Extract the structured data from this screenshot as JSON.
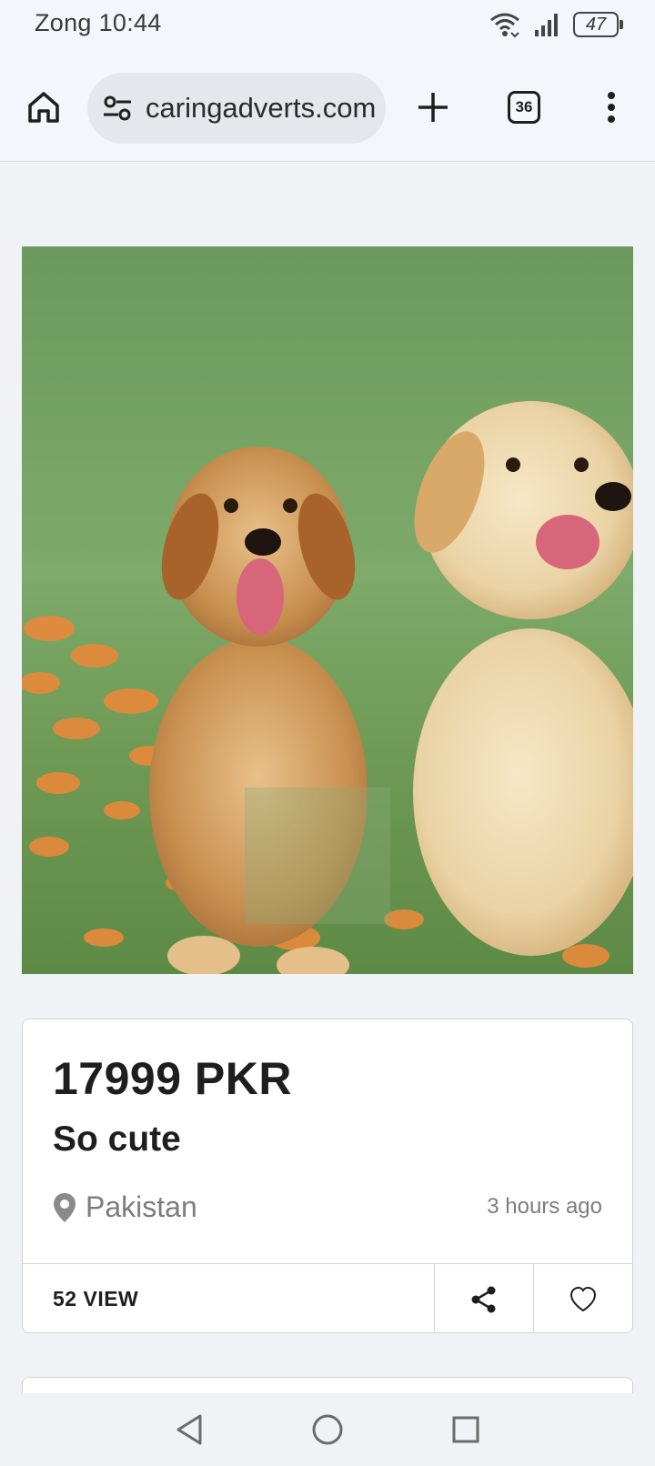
{
  "status_bar": {
    "carrier": "Zong",
    "time": "10:44",
    "battery": "47",
    "icons": [
      "wifi-icon",
      "signal-icon",
      "battery-icon"
    ]
  },
  "browser": {
    "url": "caringadverts.com",
    "tab_count": "36",
    "icons": [
      "home-icon",
      "site-settings-icon",
      "new-tab-plus-icon",
      "tab-switcher-icon",
      "overflow-menu-icon"
    ]
  },
  "listing": {
    "image": "two golden retriever puppies sitting in grass with orange flowers",
    "price": "17999 PKR",
    "title": "So cute",
    "location": "Pakistan",
    "posted": "3 hours ago",
    "views": "52 VIEW",
    "icons": [
      "location-pin-icon",
      "share-icon",
      "heart-icon"
    ]
  },
  "nav_bar": {
    "icons": [
      "back-triangle-icon",
      "home-circle-icon",
      "recents-square-icon"
    ]
  },
  "colors": {
    "page_bg": "#f1f2f6",
    "toolbar_bg": "#f3f7fb",
    "url_pill_bg": "#e4e7eb",
    "card_border": "#cfd3d8",
    "muted_text": "#7c7c7c"
  }
}
